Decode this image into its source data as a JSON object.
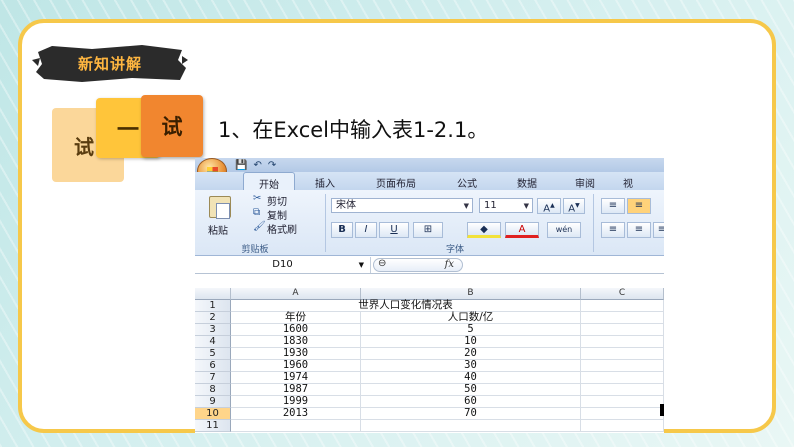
{
  "slide": {
    "badge": "新知讲解",
    "try_blocks": [
      "试",
      "一",
      "试"
    ],
    "instruction": "1、在Excel中输入表1-2.1。"
  },
  "excel": {
    "tabs": [
      "开始",
      "插入",
      "页面布局",
      "公式",
      "数据",
      "审阅",
      "视"
    ],
    "clipboard": {
      "paste": "粘贴",
      "cut": "剪切",
      "copy": "复制",
      "format_painter": "格式刷",
      "group_label": "剪贴板"
    },
    "font": {
      "name": "宋体",
      "size": "11",
      "group_label": "字体",
      "buttons": [
        "B",
        "I",
        "U",
        "A",
        "wén"
      ]
    },
    "name_box": "D10",
    "fx_label": "fx",
    "columns": [
      "A",
      "B",
      "C"
    ],
    "sheet_title": "世界人口变化情况表",
    "headers": [
      "年份",
      "人口数/亿"
    ],
    "row_numbers": [
      "1",
      "2",
      "3",
      "4",
      "5",
      "6",
      "7",
      "8",
      "9",
      "10",
      "11"
    ],
    "rows": [
      [
        "1600",
        "5"
      ],
      [
        "1830",
        "10"
      ],
      [
        "1930",
        "20"
      ],
      [
        "1960",
        "30"
      ],
      [
        "1974",
        "40"
      ],
      [
        "1987",
        "50"
      ],
      [
        "1999",
        "60"
      ],
      [
        "2013",
        "70"
      ]
    ]
  }
}
